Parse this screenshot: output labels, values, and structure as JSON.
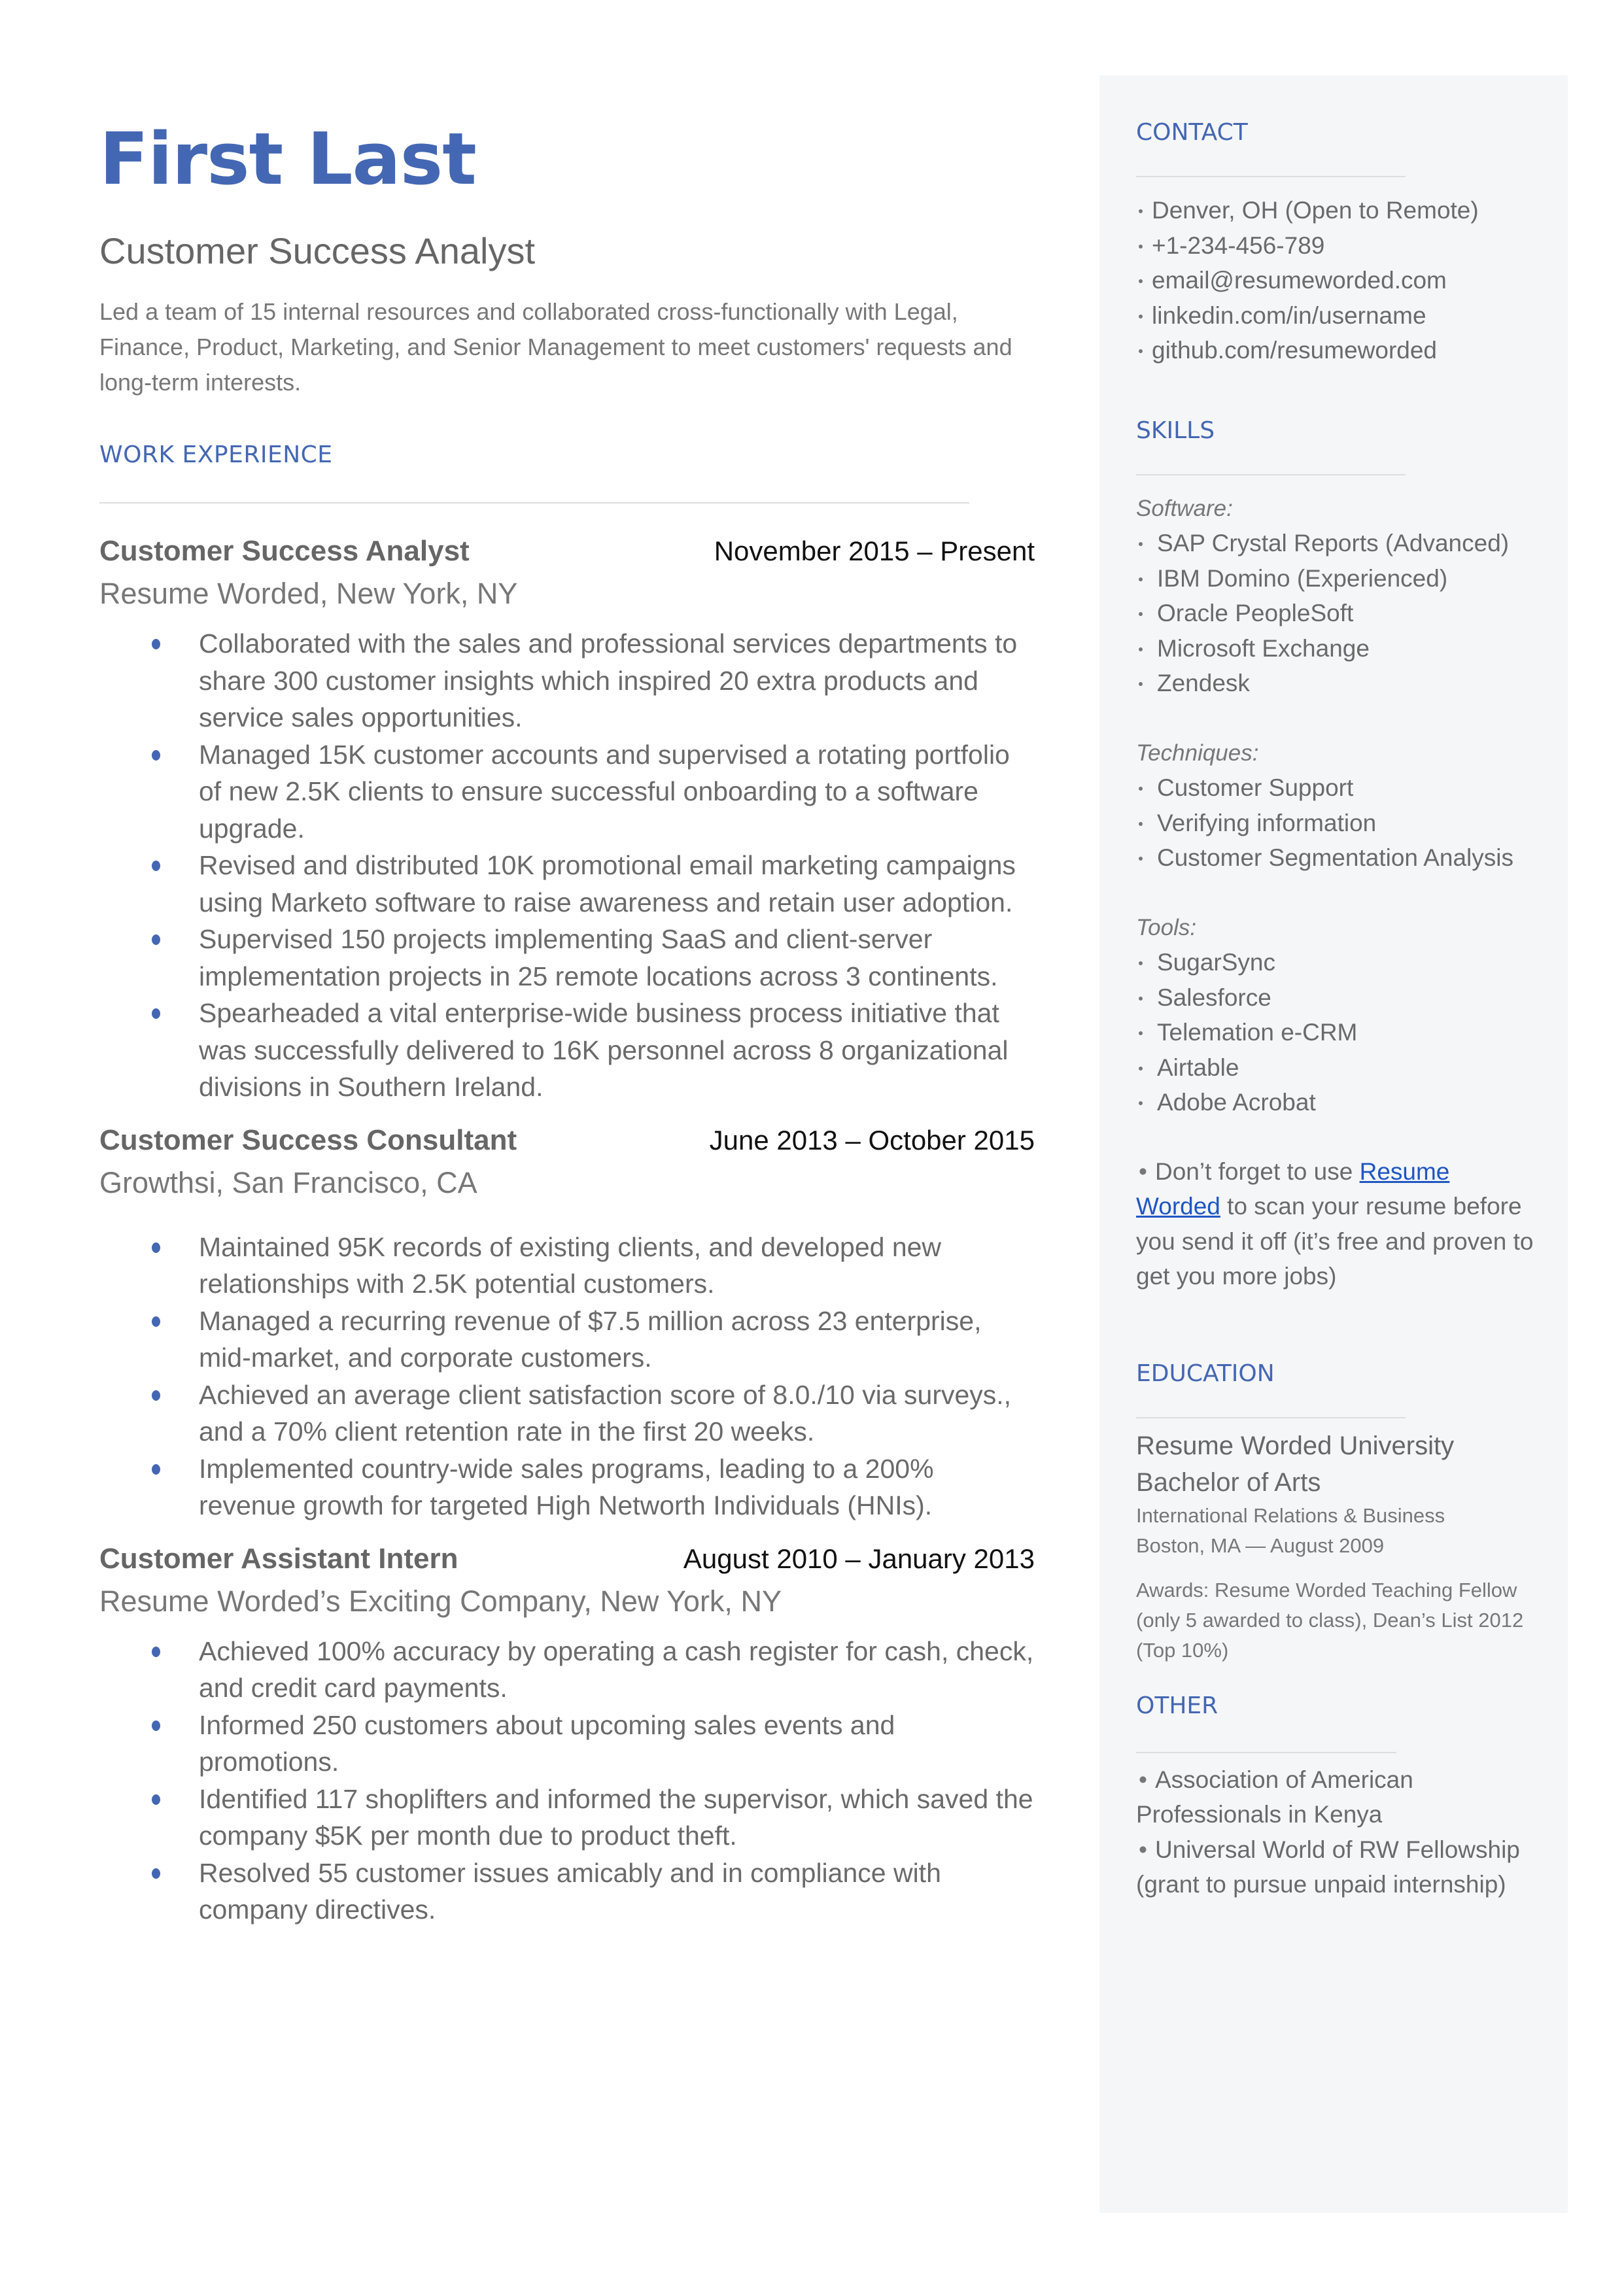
{
  "header": {
    "name": "First Last",
    "role": "Customer Success Analyst",
    "summary": "Led a team of 15 internal resources and collaborated cross-functionally with Legal, Finance, Product, Marketing, and Senior Management to meet customers' requests and long-term interests."
  },
  "work": {
    "title": "WORK EXPERIENCE",
    "jobs": [
      {
        "title": "Customer Success Analyst",
        "dates": "November 2015 – Present",
        "org": "Resume Worded, New York, NY",
        "bullets": [
          "Collaborated with the sales and professional services departments to share 300 customer insights which inspired 20 extra products and service sales opportunities.",
          "Managed 15K customer accounts and supervised a rotating portfolio of new 2.5K clients to ensure successful onboarding to a software upgrade.",
          "Revised and distributed 10K promotional email marketing campaigns using Marketo software to raise awareness and retain user adoption.",
          "Supervised 150 projects implementing SaaS and client-server implementation projects in 25 remote locations across 3 continents.",
          "Spearheaded a vital enterprise-wide business process initiative that was successfully delivered to 16K personnel across 8 organizational divisions in Southern Ireland."
        ]
      },
      {
        "title": "Customer Success Consultant",
        "dates": "June 2013 – October 2015",
        "org": "Growthsi, San Francisco, CA",
        "bullets": [
          "Maintained 95K records of existing clients, and developed new relationships with 2.5K potential customers.",
          "Managed a recurring revenue of  $7.5 million across 23 enterprise, mid-market, and corporate customers.",
          "Achieved an average client satisfaction score of 8.0./10 via surveys., and a 70% client retention rate in the first 20 weeks.",
          "Implemented country-wide sales programs, leading to a 200% revenue growth for targeted High Networth Individuals (HNIs)."
        ]
      },
      {
        "title": "Customer Assistant Intern",
        "dates": "August 2010 – January 2013",
        "org": "Resume Worded’s Exciting Company, New York, NY",
        "bullets": [
          "Achieved 100% accuracy by operating a cash register for cash, check, and credit card payments.",
          "Informed 250 customers about upcoming sales events and promotions.",
          "Identified 117 shoplifters and informed the supervisor, which saved the company $5K  per month due to product theft.",
          "Resolved 55  customer issues amicably and in compliance with company directives."
        ]
      }
    ]
  },
  "contact": {
    "title": "CONTACT",
    "items": [
      " Denver, OH (Open to Remote)",
      "+1-234-456-789",
      "email@resumeworded.com",
      "linkedin.com/in/username",
      "github.com/resumeworded"
    ]
  },
  "skills": {
    "title": "SKILLS",
    "categories": [
      {
        "label": "Software:",
        "items": [
          "SAP Crystal Reports (Advanced)",
          "IBM Domino (Experienced)",
          "Oracle PeopleSoft",
          "Microsoft Exchange",
          "Zendesk"
        ]
      },
      {
        "label": "Techniques:",
        "items": [
          "Customer Support",
          "Verifying information",
          "Customer Segmentation Analysis"
        ]
      },
      {
        "label": "Tools:",
        "items": [
          "SugarSync",
          "Salesforce",
          "Telemation e-CRM",
          "Airtable",
          "Adobe Acrobat"
        ]
      }
    ],
    "tip": {
      "before": "Don’t forget to use ",
      "link": "Resume Worded",
      "after": " to scan your resume before you send it off (it’s free and proven to get you more jobs)"
    }
  },
  "education": {
    "title": "EDUCATION",
    "school": "Resume Worded University",
    "degree": "Bachelor of Arts",
    "field": "International Relations & Business",
    "location_date": "Boston, MA — August 2009",
    "awards": "Awards: Resume Worded Teaching Fellow (only 5 awarded to class), Dean’s List 2012 (Top 10%)"
  },
  "other": {
    "title": "OTHER",
    "items": [
      "Association of American Professionals in Kenya",
      "Universal World of RW Fellowship (grant to pursue unpaid internship)"
    ]
  },
  "colors": {
    "accent": "#4467b3",
    "link": "#1f57c3",
    "sidebar_bg": "#f5f6f8",
    "text": "#666666"
  }
}
